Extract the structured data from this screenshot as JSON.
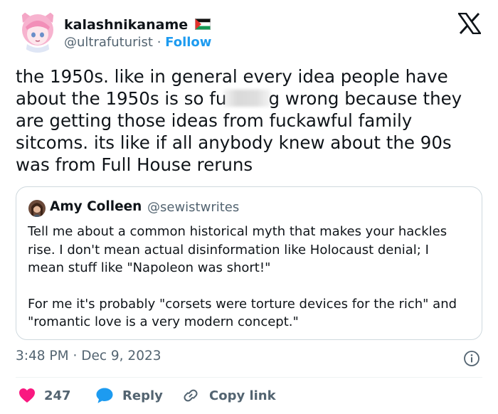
{
  "author": {
    "display_name": "kalashnikaname",
    "flag": "palestine-flag-emoji",
    "handle": "@ultrafuturist",
    "separator": "·",
    "follow_label": "Follow"
  },
  "tweet": {
    "text_before": "the 1950s. like in general every idea people have about the 1950s is so fu",
    "redacted": "blurred-word",
    "text_after": "g wrong because they are getting those ideas from fuckawful family sitcoms. its like if all anybody knew about the 90s was from Full House reruns"
  },
  "quote": {
    "display_name": "Amy Colleen",
    "handle": "@sewistwrites",
    "paragraph1": "Tell me about a common historical myth that makes your hackles rise. I don't mean actual disinformation like Holocaust denial; I mean stuff like \"Napoleon was short!\"",
    "paragraph2": "For me it's probably \"corsets were torture devices for the rich\" and \"romantic love is a very modern concept.\""
  },
  "meta": {
    "time": "3:48 PM",
    "separator": "·",
    "date": "Dec 9, 2023"
  },
  "actions": {
    "like_count": "247",
    "reply_label": "Reply",
    "copy_label": "Copy link"
  },
  "colors": {
    "text": "#0f1419",
    "secondary": "#536471",
    "link": "#1d9bf0",
    "heart": "#f91880",
    "border": "#cfd9de"
  }
}
